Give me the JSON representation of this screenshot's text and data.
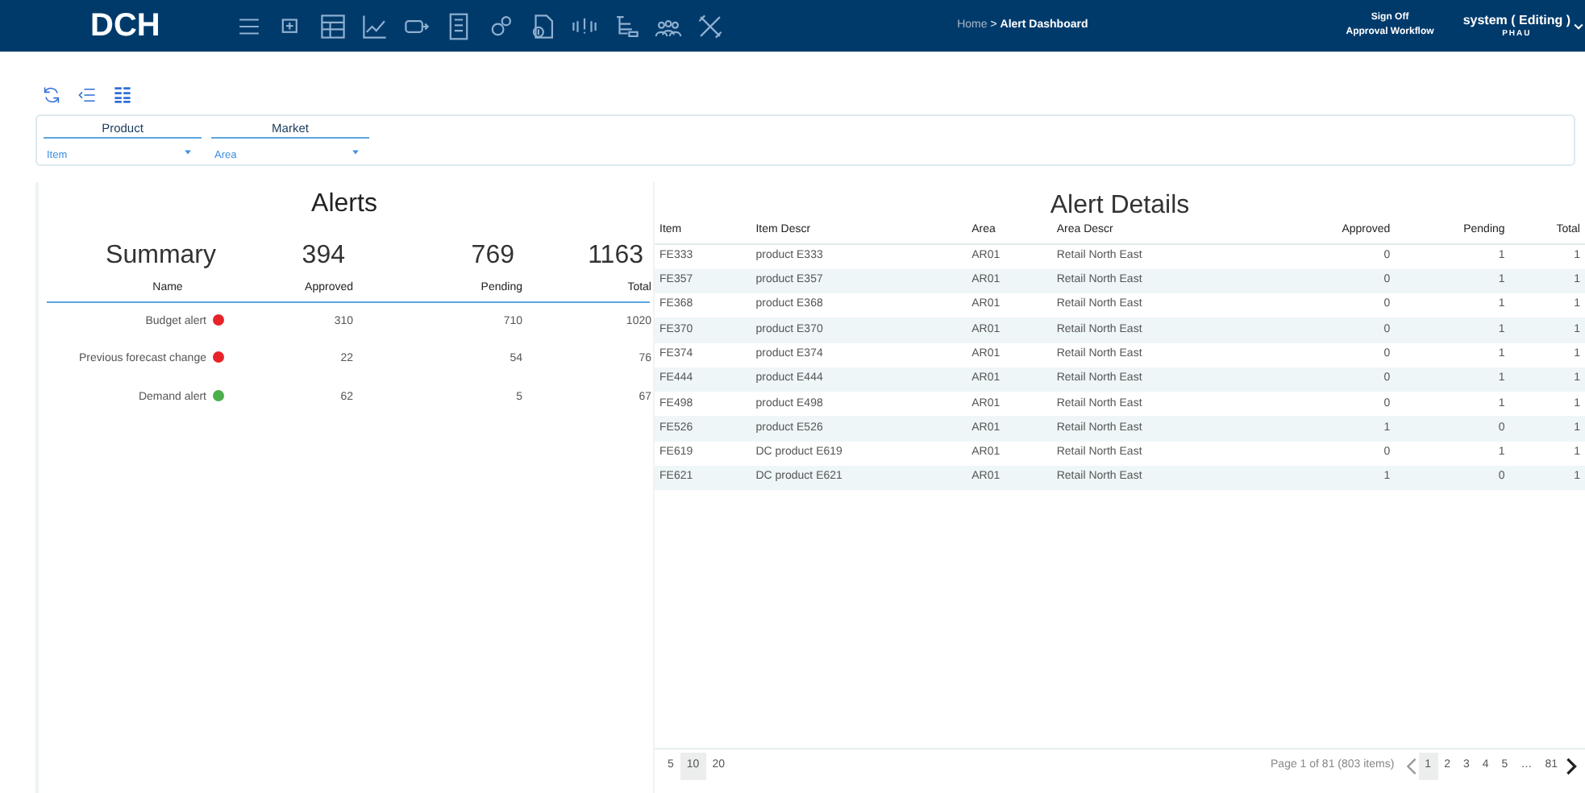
{
  "navbar": {
    "logo": "DCH",
    "breadcrumb": {
      "parent": "Home",
      "separator": ">",
      "current": "Alert Dashboard"
    },
    "links": [
      "Sign Off",
      "Approval Workflow"
    ],
    "user": {
      "name": "system ( Editing )",
      "sub": "PHAU"
    }
  },
  "filters": [
    {
      "label": "Product",
      "value": "Item"
    },
    {
      "label": "Market",
      "value": "Area"
    }
  ],
  "alerts": {
    "title": "Alerts",
    "summary": {
      "label": "Summary",
      "approved": "394",
      "pending": "769",
      "total": "1163"
    },
    "columns": [
      "Name",
      "Approved",
      "Pending",
      "Total"
    ],
    "rows": [
      {
        "name": "Budget alert",
        "color": "#e8222a",
        "approved": "310",
        "pending": "710",
        "total": "1020"
      },
      {
        "name": "Previous forecast change",
        "color": "#e8222a",
        "approved": "22",
        "pending": "54",
        "total": "76"
      },
      {
        "name": "Demand alert",
        "color": "#4cae4c",
        "approved": "62",
        "pending": "5",
        "total": "67"
      }
    ]
  },
  "details": {
    "title": "Alert Details",
    "columns": [
      "Item",
      "Item Descr",
      "Area",
      "Area Descr",
      "Approved",
      "Pending",
      "Total"
    ],
    "rows": [
      [
        "FE333",
        "product E333",
        "AR01",
        "Retail North East",
        "0",
        "1",
        "1"
      ],
      [
        "FE357",
        "product E357",
        "AR01",
        "Retail North East",
        "0",
        "1",
        "1"
      ],
      [
        "FE368",
        "product E368",
        "AR01",
        "Retail North East",
        "0",
        "1",
        "1"
      ],
      [
        "FE370",
        "product E370",
        "AR01",
        "Retail North East",
        "0",
        "1",
        "1"
      ],
      [
        "FE374",
        "product E374",
        "AR01",
        "Retail North East",
        "0",
        "1",
        "1"
      ],
      [
        "FE444",
        "product E444",
        "AR01",
        "Retail North East",
        "0",
        "1",
        "1"
      ],
      [
        "FE498",
        "product E498",
        "AR01",
        "Retail North East",
        "0",
        "1",
        "1"
      ],
      [
        "FE526",
        "product E526",
        "AR01",
        "Retail North East",
        "1",
        "0",
        "1"
      ],
      [
        "FE619",
        "DC product E619",
        "AR01",
        "Retail North East",
        "0",
        "1",
        "1"
      ],
      [
        "FE621",
        "DC product E621",
        "AR01",
        "Retail North East",
        "1",
        "0",
        "1"
      ]
    ],
    "page_sizes": [
      {
        "label": "5",
        "selected": false
      },
      {
        "label": "10",
        "selected": true
      },
      {
        "label": "20",
        "selected": false
      }
    ],
    "page_info": "Page 1 of 81 (803 items)",
    "pages": [
      {
        "label": "1",
        "selected": true
      },
      {
        "label": "2",
        "selected": false
      },
      {
        "label": "3",
        "selected": false
      },
      {
        "label": "4",
        "selected": false
      },
      {
        "label": "5",
        "selected": false
      },
      {
        "label": "…",
        "selected": false
      },
      {
        "label": "81",
        "selected": false
      }
    ]
  }
}
